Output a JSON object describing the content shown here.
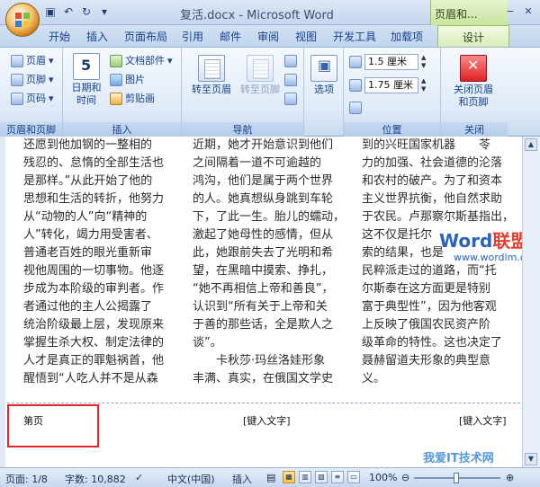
{
  "title_bar": {
    "title": "复活.docx - Microsoft Word",
    "context_tab_title": "页眉和...",
    "qat": [
      "save-icon",
      "undo-icon",
      "redo-icon",
      "customize-icon"
    ]
  },
  "tabs": [
    "开始",
    "插入",
    "页面布局",
    "引用",
    "邮件",
    "审阅",
    "视图",
    "开发工具",
    "加载项"
  ],
  "active_tab": "设计",
  "ribbon": {
    "group1": {
      "label": "页眉和页脚",
      "items": [
        "页眉",
        "页脚",
        "页码"
      ]
    },
    "group2": {
      "label": "插入",
      "date_time": "日期和\n时间",
      "items": [
        "文档部件",
        "图片",
        "剪贴画"
      ]
    },
    "group3": {
      "label": "导航",
      "goto_header": "转至页眉",
      "goto_footer": "转至页脚"
    },
    "options": "选项",
    "group4": {
      "label": "位置",
      "header_pos": "1.5 厘米",
      "footer_pos": "1.75 厘米"
    },
    "group5": {
      "label": "关闭",
      "close": "关闭页眉\n和页脚"
    }
  },
  "document": {
    "col1": [
      "还愿到他加钢的一整相的",
      "残忍的、怠惰的全部生活也",
      "是那样。”从此开始了他的",
      "思想和生活的转折，他努力",
      "从“动物的人”向“精神的",
      "人”转化，竭力用受害者、",
      "普通老百姓的眼光重新审",
      "视他周围的一切事物。他逐",
      "步成为本阶级的审判者。作",
      "者通过他的主人公揭露了",
      "统治阶级最上层，发现原来",
      "掌握生杀大权、制定法律的",
      "人才是真正的罪魁祸首，他",
      "醒悟到“人吃人并不是从森"
    ],
    "col2": [
      "近期，她才开始意识到他们",
      "之间隔着一道不可逾越的",
      "鸿沟，他们是属于两个世界",
      "的人。她真想纵身跳到车轮",
      "下，了此一生。胎儿的蠕动，",
      "激起了她母性的感情，但从",
      "此，她跟前失去了光明和希",
      "望，在黑暗中摸索、挣扎，",
      "“她不再相信上帝和善良”，",
      "认识到“所有关于上帝和关",
      "于善的那些话，全是欺人之",
      "谈”。",
      "　　卡秋莎·玛丝洛娃形象",
      "丰满、真实，在俄国文学史"
    ],
    "col3": [
      "到的兴旺国家机器　　苓",
      "力的加强、社会道德的沦落",
      "和农村的破产。为了和资本",
      "主义世界抗衡，他自然求助",
      "于农民。卢那察尔斯基指出，",
      "这不仅是托尔",
      "索的结果，也是",
      "民粹派走过的道路，而“托",
      "尔斯泰在这方面更是特别",
      "富于典型性”，因为他客观",
      "上反映了俄国农民资产阶",
      "级革命的特性。这也决定了",
      "聂赫留道夫形象的典型意",
      "义。"
    ],
    "footer_left": "第页",
    "footer_mid": "[键入文字]",
    "footer_right": "[键入文字]",
    "watermark_word": "Word",
    "watermark_lm": "联盟",
    "watermark_url": "www.wordlm.com",
    "bottom_watermark": "我爱IT技术网"
  },
  "status": {
    "page": "页面: 1/8",
    "words": "字数: 10,882",
    "lang": "中文(中国)",
    "insert": "插入",
    "zoom": "100%"
  }
}
